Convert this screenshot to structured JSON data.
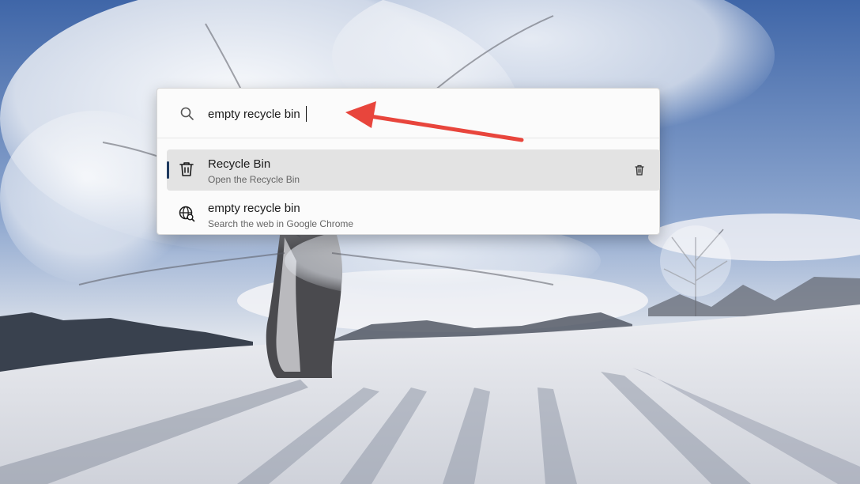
{
  "search": {
    "query": "empty recycle bin",
    "icon": "search-icon"
  },
  "results": [
    {
      "title": "Recycle Bin",
      "subtitle": "Open the Recycle Bin",
      "icon": "recycle-bin-icon",
      "action_icon": "delete-icon",
      "selected": true
    },
    {
      "title": "empty recycle bin",
      "subtitle": "Search the web in Google Chrome",
      "icon": "web-search-icon",
      "selected": false
    }
  ],
  "colors": {
    "selection_bar": "#1f3a5f",
    "selected_row": "#e3e3e3",
    "annotation_arrow": "#e8453c"
  }
}
